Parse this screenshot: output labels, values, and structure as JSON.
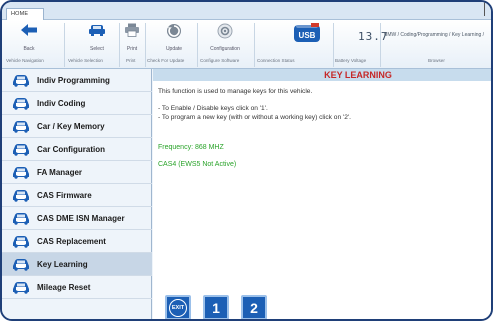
{
  "tabs": {
    "home": "HOME"
  },
  "toolbar": {
    "back": "Back",
    "select": "Select",
    "print": "Print",
    "update": "Update",
    "configuration": "Configuration",
    "usb": "USB",
    "voltage": "13.7",
    "breadcrumb": "BMW / Coding/Programming / Key Learning /"
  },
  "toolbar_groups": {
    "vehicle_navigation": "Vehicle Navigation",
    "vehicle_selection": "Vehicle Selection",
    "print": "Print",
    "check_for_update": "Check For Update",
    "configure_software": "Configure Software",
    "connection_status": "Connection Status",
    "battery_voltage": "Battery Voltage",
    "browser": "Browser"
  },
  "sidebar": {
    "items": [
      {
        "label": "Indiv Programming"
      },
      {
        "label": "Indiv Coding"
      },
      {
        "label": "Car / Key Memory"
      },
      {
        "label": "Car Configuration"
      },
      {
        "label": "FA Manager"
      },
      {
        "label": "CAS Firmware"
      },
      {
        "label": "CAS DME ISN Manager"
      },
      {
        "label": "CAS Replacement"
      },
      {
        "label": "Key Learning"
      },
      {
        "label": "Mileage Reset"
      }
    ],
    "active_index": 8
  },
  "content": {
    "title": "KEY LEARNING",
    "description": "This function is used to manage keys for this vehicle.",
    "instruction_1": "- To Enable / Disable keys click on '1'.",
    "instruction_2": "- To program a new key (with or without a working key) click on '2'.",
    "frequency": "Frequency: 868 MHZ",
    "cas_status": "CAS4 (EWS5 Not Active)"
  },
  "buttons": {
    "exit": "EXIT",
    "one": "1",
    "two": "2"
  },
  "colors": {
    "title_red": "#c62828",
    "status_green": "#29a329",
    "button_blue": "#1c5fb5",
    "frame_navy": "#1f3f78"
  }
}
